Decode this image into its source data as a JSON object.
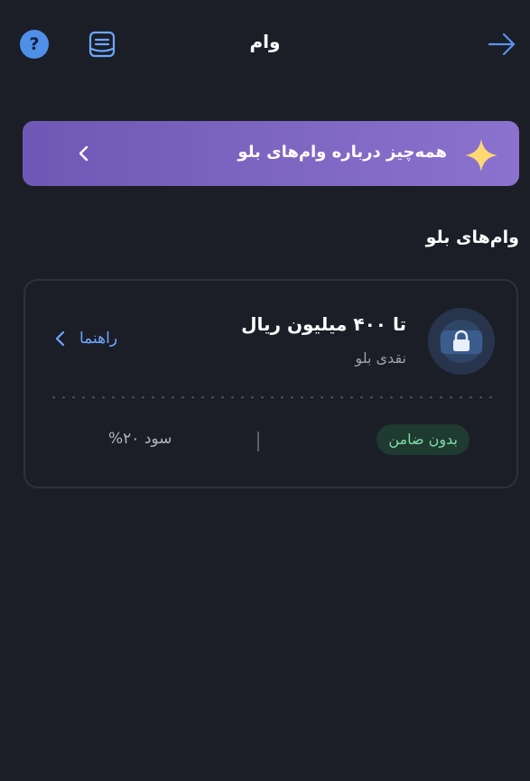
{
  "header": {
    "title": "وام",
    "back_icon": "arrow-right-icon",
    "help_icon": "question-circle-icon",
    "help_glyph": "?",
    "list_icon": "document-list-icon"
  },
  "banner": {
    "label": "همه‌چیز درباره وام‌های بلو",
    "icon": "sparkle-star-icon",
    "chevron_icon": "chevron-left-icon",
    "accent_start": "#6f58b5",
    "accent_end": "#8b72cf"
  },
  "section": {
    "title": "وام‌های بلو"
  },
  "loan": {
    "title": "تا ۴۰۰ میلیون ریال",
    "subtitle": "نقدی بلو",
    "icon": "lock-icon",
    "guide_label": "راهنما",
    "guide_icon": "chevron-left-icon",
    "badge": "بدون ضامن",
    "interest": "سود ۲۰%",
    "badge_color": "#7fdca4",
    "link_color": "#6da8ff"
  }
}
